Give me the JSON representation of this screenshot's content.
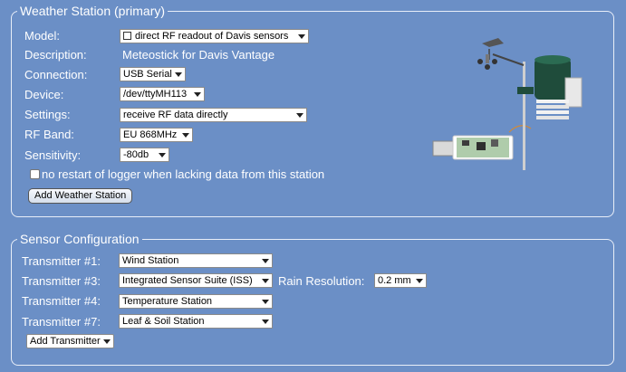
{
  "weather_station": {
    "legend": "Weather Station (primary)",
    "model_label": "Model:",
    "model_value": "direct RF readout of Davis sensors",
    "description_label": "Description:",
    "description_value": "Meteostick for Davis Vantage",
    "connection_label": "Connection:",
    "connection_value": "USB Serial",
    "device_label": "Device:",
    "device_value": "/dev/ttyMH113",
    "settings_label": "Settings:",
    "settings_value": "receive RF data directly",
    "rfband_label": "RF Band:",
    "rfband_value": "EU 868MHz",
    "sensitivity_label": "Sensitivity:",
    "sensitivity_value": "-80db",
    "no_restart_label": "no restart of logger when lacking data from this station",
    "no_restart_checked": false,
    "add_button": "Add Weather Station"
  },
  "sensor_config": {
    "legend": "Sensor Configuration",
    "transmitters": [
      {
        "label": "Transmitter #1:",
        "value": "Wind Station"
      },
      {
        "label": "Transmitter #3:",
        "value": "Integrated Sensor Suite (ISS)"
      },
      {
        "label": "Transmitter #4:",
        "value": "Temperature Station"
      },
      {
        "label": "Transmitter #7:",
        "value": "Leaf & Soil Station"
      }
    ],
    "rain_resolution_label": "Rain Resolution:",
    "rain_resolution_value": "0.2 mm",
    "add_transmitter": "Add Transmitter"
  },
  "colors": {
    "background": "#6b8fc6",
    "border": "#e8eef8"
  }
}
